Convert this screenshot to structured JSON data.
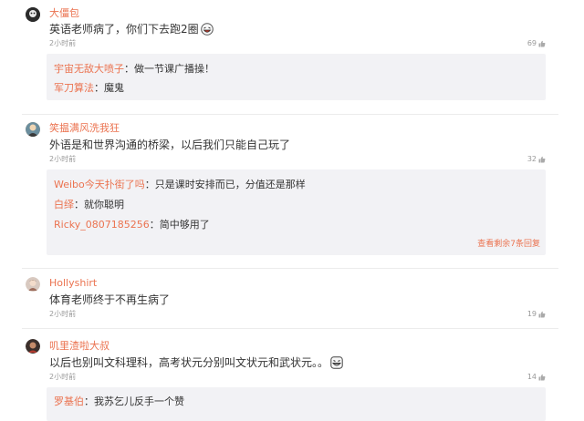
{
  "comments": [
    {
      "user": "大僵包",
      "text": "英语老师病了，你们下去跑2圈",
      "emoji_icon": "laughing-face-icon",
      "time": "2小时前",
      "likes": "69",
      "replies": [
        {
          "name": "宇宙无敌大喷子",
          "text": "：做一节课广播操！"
        },
        {
          "name": "军刀算法",
          "text": "：魔鬼"
        }
      ]
    },
    {
      "user": "笑揾满风洗我狂",
      "text": "外语是和世界沟通的桥梁，以后我们只能自己玩了",
      "time": "2小时前",
      "likes": "32",
      "replies": [
        {
          "name": "Weibo今天扑街了吗",
          "text": "：只是课时安排而已，分值还是那样"
        },
        {
          "name": "白绎",
          "text": "：就你聪明"
        },
        {
          "name": "Ricky_0807185256",
          "text": "：简中够用了"
        }
      ],
      "more_replies": "查看剩余7条回复"
    },
    {
      "user": "Hollyshirt",
      "text": "体育老师终于不再生病了",
      "time": "2小时前",
      "likes": "19",
      "replies": []
    },
    {
      "user": "叽里渣啦大叔",
      "text": "以后也别叫文科理科，高考状元分别叫文状元和武状元。。",
      "emoji_icon": "grinning-face-icon",
      "time": "2小时前",
      "likes": "14",
      "replies": [
        {
          "name": "罗基伯",
          "text": "：我苏乞儿反手一个赞"
        }
      ]
    }
  ],
  "colors": {
    "username": "#eb7350",
    "reply_bg": "#f2f2f5",
    "meta": "#999999"
  }
}
